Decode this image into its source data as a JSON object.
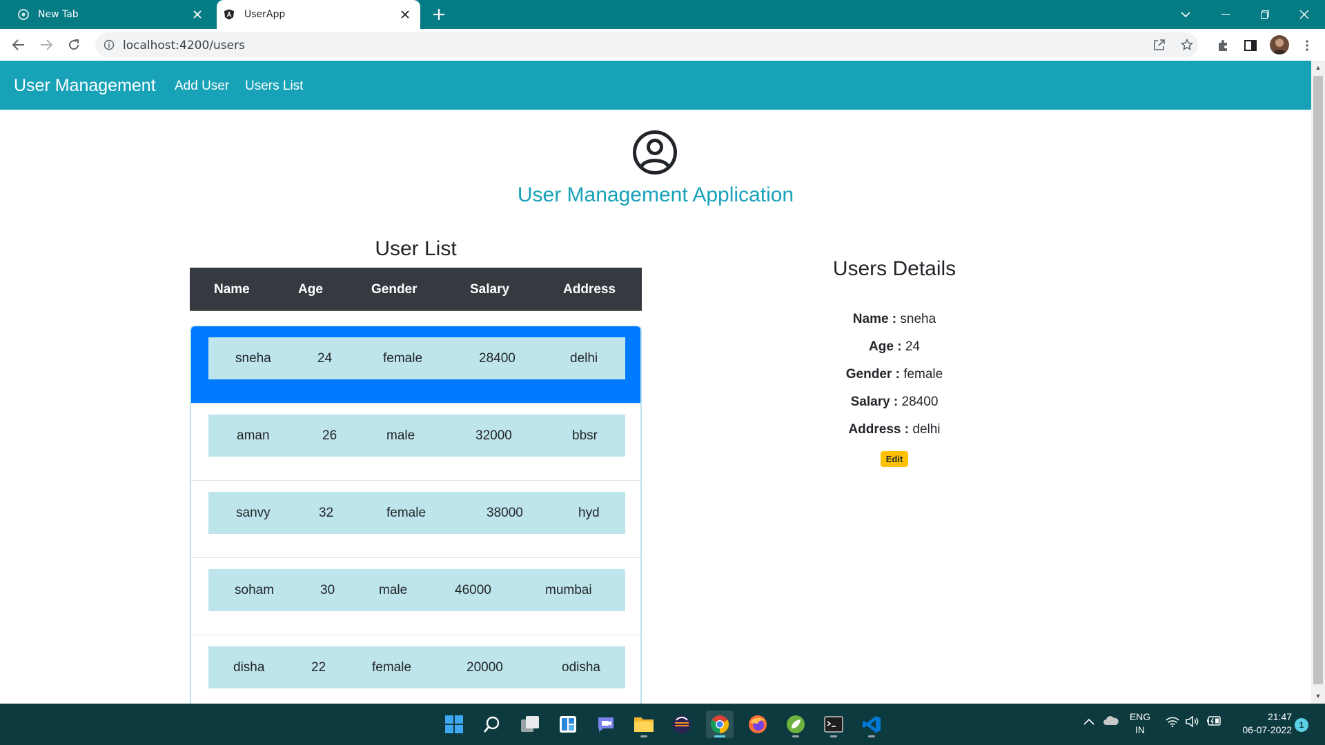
{
  "browser": {
    "tabs": [
      {
        "title": "New Tab",
        "icon": "chrome-icon",
        "active": false
      },
      {
        "title": "UserApp",
        "icon": "angular-icon",
        "active": true
      }
    ],
    "url": "localhost:4200/users"
  },
  "navbar": {
    "brand": "User Management",
    "links": [
      "Add User",
      "Users List"
    ],
    "color": "#17a2b8"
  },
  "page": {
    "title": "User Management Application",
    "list_title": "User List",
    "columns": [
      "Name",
      "Age",
      "Gender",
      "Salary",
      "Address"
    ],
    "rows": [
      {
        "name": "sneha",
        "age": "24",
        "gender": "female",
        "salary": "28400",
        "address": "delhi",
        "selected": true
      },
      {
        "name": "aman",
        "age": "26",
        "gender": "male",
        "salary": "32000",
        "address": "bbsr",
        "selected": false
      },
      {
        "name": "sanvy",
        "age": "32",
        "gender": "female",
        "salary": "38000",
        "address": "hyd",
        "selected": false
      },
      {
        "name": "soham",
        "age": "30",
        "gender": "male",
        "salary": "46000",
        "address": "mumbai",
        "selected": false
      },
      {
        "name": "disha",
        "age": "22",
        "gender": "female",
        "salary": "20000",
        "address": "odisha",
        "selected": false
      }
    ]
  },
  "details": {
    "title": "Users Details",
    "fields": [
      {
        "label": "Name :",
        "value": "sneha"
      },
      {
        "label": "Age :",
        "value": "24"
      },
      {
        "label": "Gender :",
        "value": "female"
      },
      {
        "label": "Salary :",
        "value": "28400"
      },
      {
        "label": "Address :",
        "value": "delhi"
      }
    ],
    "edit_label": "Edit"
  },
  "taskbar": {
    "language": "ENG",
    "region": "IN",
    "time": "21:47",
    "date": "06-07-2022",
    "notifications": "1"
  }
}
